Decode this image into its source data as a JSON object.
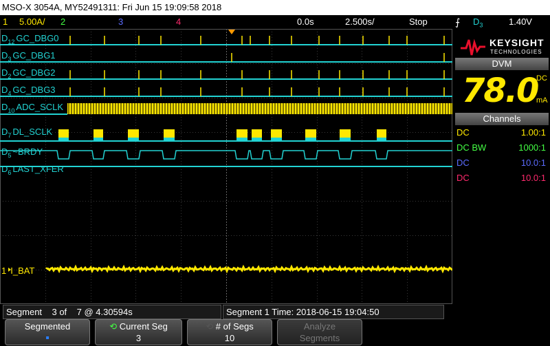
{
  "title": "MSO-X 3054A, MY52491311: Fri Jun 15 19:09:58 2018",
  "status": {
    "ch1_num": "1",
    "ch1_scale": "5.00A/",
    "ch2_num": "2",
    "ch3_num": "3",
    "ch4_num": "4",
    "delay": "0.0s",
    "timebase": "2.500s/",
    "run_state": "Stop",
    "trig_source": "D",
    "trig_source_sub": "3",
    "trig_level": "1.40V"
  },
  "digital_channels": [
    {
      "num": "D",
      "sub": "12",
      "name": "GC_DBG0"
    },
    {
      "num": "D",
      "sub": "3",
      "name": "GC_DBG1"
    },
    {
      "num": "D",
      "sub": "2",
      "name": "GC_DBG2"
    },
    {
      "num": "D",
      "sub": "4",
      "name": "GC_DBG3"
    },
    {
      "num": "D",
      "sub": "10",
      "name": "ADC_SCLK"
    },
    {
      "num": "D",
      "sub": "7",
      "name": "DL_SCLK"
    },
    {
      "num": "D",
      "sub": "5",
      "name": "~BRDY"
    },
    {
      "num": "D",
      "sub": "6",
      "name": "LAST_XFER"
    }
  ],
  "analog_channel": {
    "num": "1",
    "name": "I_BAT"
  },
  "brand": {
    "name": "KEYSIGHT",
    "sub": "TECHNOLOGIES"
  },
  "dvm": {
    "label": "DVM",
    "value": "78.0",
    "mode": "DC",
    "unit": "mA"
  },
  "channels_panel": {
    "title": "Channels",
    "rows": [
      {
        "coupling": "DC",
        "ratio": "1.00:1",
        "color": "#ffe800"
      },
      {
        "coupling": "DC BW",
        "ratio": "1000:1",
        "color": "#44ff44"
      },
      {
        "coupling": "DC",
        "ratio": "10.0:1",
        "color": "#5b6cff"
      },
      {
        "coupling": "DC",
        "ratio": "10.0:1",
        "color": "#ff2a6d"
      }
    ]
  },
  "segment_info": {
    "left": "Segment    3 of    7 @ 4.30594s",
    "right": "Segment 1 Time: 2018-06-15 19:04:50"
  },
  "softkeys": [
    {
      "label": "Segmented",
      "value": "▪"
    },
    {
      "label": "Current Seg",
      "value": "3"
    },
    {
      "label": "# of Segs",
      "value": "10"
    },
    {
      "label": "Analyze",
      "value": "Segments"
    }
  ],
  "colors": {
    "ch1": "#ffe800",
    "ch2": "#44ff44",
    "ch3": "#5b6cff",
    "ch4": "#ff2a6d",
    "digital_trace": "#22d3d3",
    "digital_active": "#ffe800",
    "trigger": "#ff9900"
  }
}
